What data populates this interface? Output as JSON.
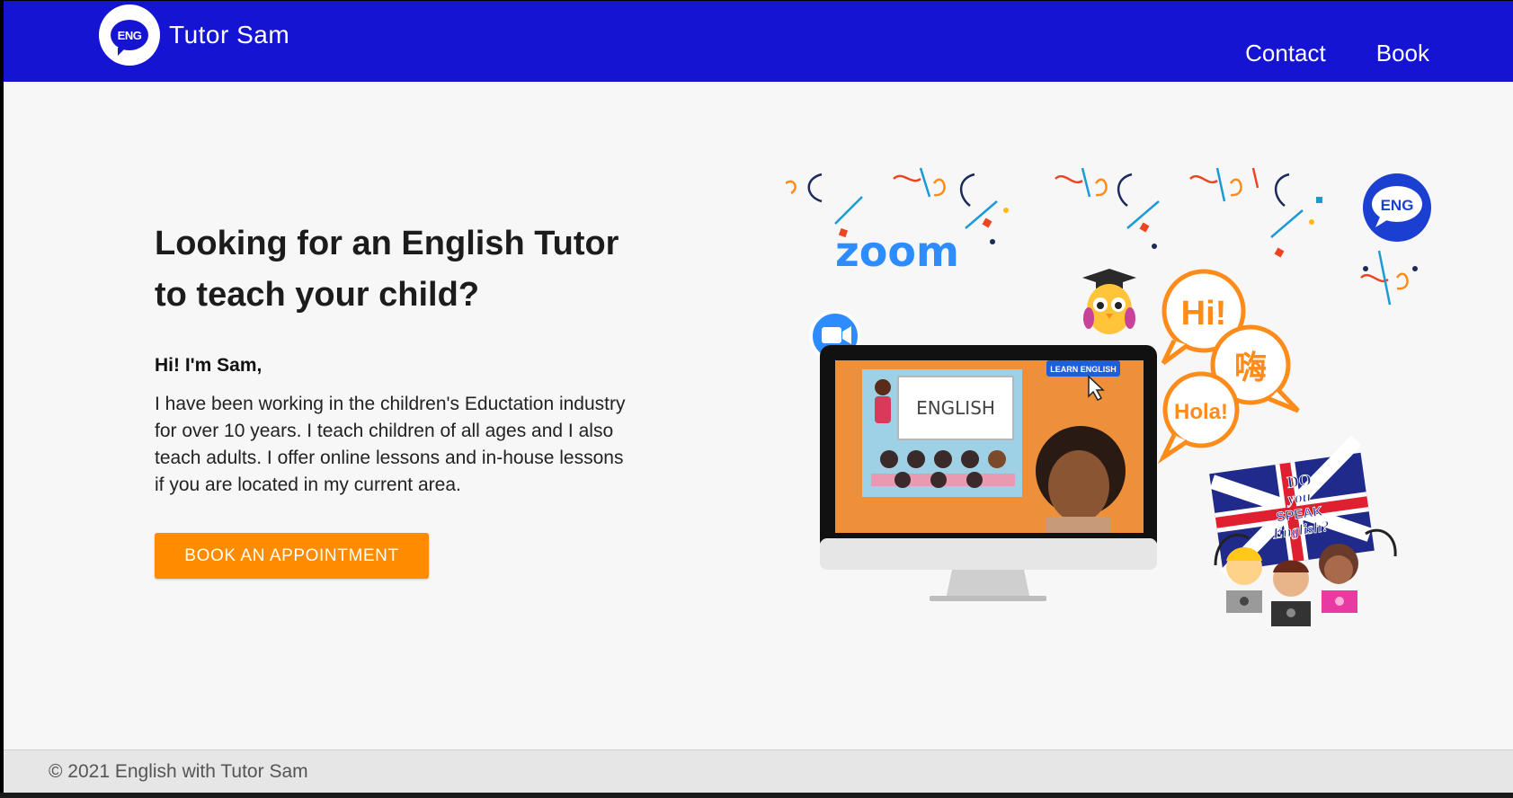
{
  "header": {
    "logo_text": "ENG",
    "brand_name": "Tutor Sam",
    "nav": [
      {
        "label": "Contact"
      },
      {
        "label": "Book"
      }
    ]
  },
  "hero": {
    "title": "Looking for an English Tutor to teach your child?",
    "greeting": "Hi! I'm Sam,",
    "intro": "I have been working in the children's Eductation industry for over 10 years. I teach children of all ages and I also teach adults. I offer online lessons and in-house lessons if you are located in my current area.",
    "cta_label": "BOOK AN APPOINTMENT"
  },
  "illustration": {
    "zoom_text": "zoom",
    "badge_text": "ENG",
    "speech": [
      "Hi!",
      "嗨",
      "Hola!"
    ],
    "board_text": "ENGLISH",
    "screen_button": "LEARN ENGLISH",
    "flag_text": [
      "DO",
      "you",
      "SPEAK",
      "English?"
    ]
  },
  "footer": {
    "copyright": "© 2021 English with Tutor Sam"
  },
  "colors": {
    "header_bg": "#1414d2",
    "accent": "#ff8c00",
    "page_bg": "#f7f7f7",
    "footer_bg": "#e6e6e6"
  }
}
